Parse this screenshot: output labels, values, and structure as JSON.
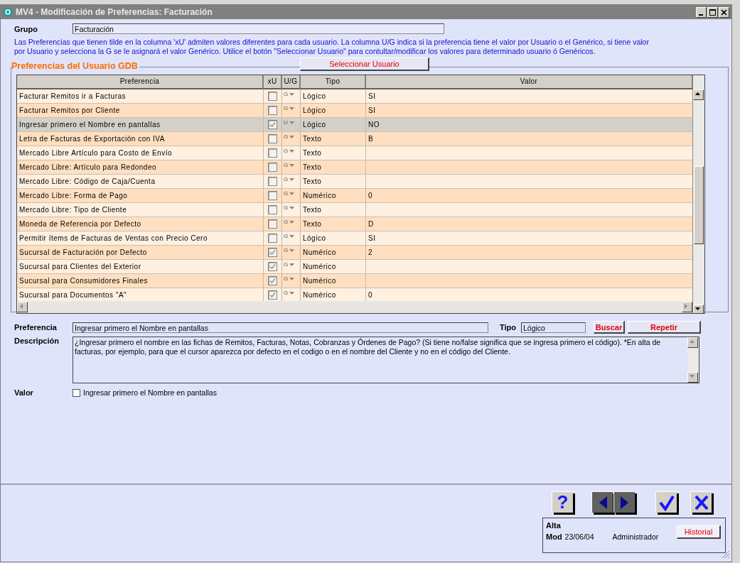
{
  "window": {
    "title": "MV4 - Modificación de Preferencias: Facturación"
  },
  "grupo": {
    "label": "Grupo",
    "value": "Facturación"
  },
  "info": "Las Preferencias que tienen tilde en la columna 'xU' admiten valores diferentes para cada usuario. La columna U/G indica si la preferencia tiene el valor por Usuario o el Genérico, si tiene valor por Usuario y selecciona la G se le asignará el valor Genérico. Utilice el botón \"Seleccionar Usuario\" para contultar/modificar los valores para determinado usuario ó Genéricos.",
  "section": {
    "title": "Preferencias del Usuario GDB",
    "button": "Seleccionar Usuario"
  },
  "table": {
    "columns": [
      "Preferencia",
      "xU",
      "U/G",
      "Tipo",
      "Valor"
    ],
    "rows": [
      {
        "preferencia": "Facturar Remitos ir a Facturas",
        "xu": false,
        "ug": "G",
        "tipo": "Lógico",
        "valor": "SI",
        "selected": false
      },
      {
        "preferencia": "Facturar Remitos por Cliente",
        "xu": false,
        "ug": "G",
        "tipo": "Lógico",
        "valor": "SI",
        "selected": false
      },
      {
        "preferencia": "Ingresar primero el Nombre en pantallas",
        "xu": true,
        "ug": "U",
        "tipo": "Lógico",
        "valor": "NO",
        "selected": true
      },
      {
        "preferencia": "Letra de Facturas de Exportación con IVA",
        "xu": false,
        "ug": "G",
        "tipo": "Texto",
        "valor": "B",
        "selected": false
      },
      {
        "preferencia": "Mercado Libre Artículo para Costo de Envío",
        "xu": false,
        "ug": "G",
        "tipo": "Texto",
        "valor": "",
        "selected": false
      },
      {
        "preferencia": "Mercado Libre: Artículo para Redondeo",
        "xu": false,
        "ug": "G",
        "tipo": "Texto",
        "valor": "",
        "selected": false
      },
      {
        "preferencia": "Mercado Libre: Código de Caja/Cuenta",
        "xu": false,
        "ug": "G",
        "tipo": "Texto",
        "valor": "",
        "selected": false
      },
      {
        "preferencia": "Mercado Libre: Forma de Pago",
        "xu": false,
        "ug": "G",
        "tipo": "Numérico",
        "valor": "0",
        "selected": false
      },
      {
        "preferencia": "Mercado Libre: Tipo de Cliente",
        "xu": false,
        "ug": "G",
        "tipo": "Texto",
        "valor": "",
        "selected": false
      },
      {
        "preferencia": "Moneda de Referencia por Defecto",
        "xu": false,
        "ug": "G",
        "tipo": "Texto",
        "valor": "D",
        "selected": false
      },
      {
        "preferencia": "Permitir ítems de Facturas de Ventas con Precio Cero",
        "xu": false,
        "ug": "G",
        "tipo": "Lógico",
        "valor": "SI",
        "selected": false
      },
      {
        "preferencia": "Sucursal de Facturación por Defecto",
        "xu": true,
        "ug": "G",
        "tipo": "Numérico",
        "valor": "2",
        "selected": false
      },
      {
        "preferencia": "Sucursal para Clientes del Exterior",
        "xu": true,
        "ug": "G",
        "tipo": "Numérico",
        "valor": "",
        "selected": false
      },
      {
        "preferencia": "Sucursal para Consumidores Finales",
        "xu": true,
        "ug": "G",
        "tipo": "Numérico",
        "valor": "",
        "selected": false
      },
      {
        "preferencia": "Sucursal para Documentos \"A\"",
        "xu": true,
        "ug": "G",
        "tipo": "Numérico",
        "valor": "0",
        "selected": false
      }
    ]
  },
  "detail": {
    "preferencia_label": "Preferencia",
    "preferencia": "Ingresar primero el Nombre en pantallas",
    "tipo_label": "Tipo",
    "tipo": "Lógico",
    "buscar": "Buscar",
    "repetir": "Repetir",
    "descripcion_label": "Descripción",
    "descripcion": "¿Ingresar primero el nombre en las fichas de Remitos, Facturas, Notas, Cobranzas y Órdenes de Pago? (Si tiene no/false significa que se ingresa primero el código). *En alta de facturas, por ejemplo, para que el cursor aparezca por defecto en el codigo o en el nombre del Cliente y no en el código del Cliente.",
    "valor_label": "Valor",
    "valor_checkbox": {
      "label": "Ingresar primero el Nombre en pantallas",
      "checked": false
    }
  },
  "footer": {
    "buttons": [
      {
        "kind": "help",
        "glyph": "?"
      },
      {
        "kind": "prev"
      },
      {
        "kind": "next"
      },
      {
        "kind": "ok"
      },
      {
        "kind": "cancel"
      }
    ],
    "alta_label": "Alta",
    "mod_label": "Mod",
    "mod_date": "23/06/04",
    "mod_user": "Administrador",
    "historial": "Historial"
  }
}
